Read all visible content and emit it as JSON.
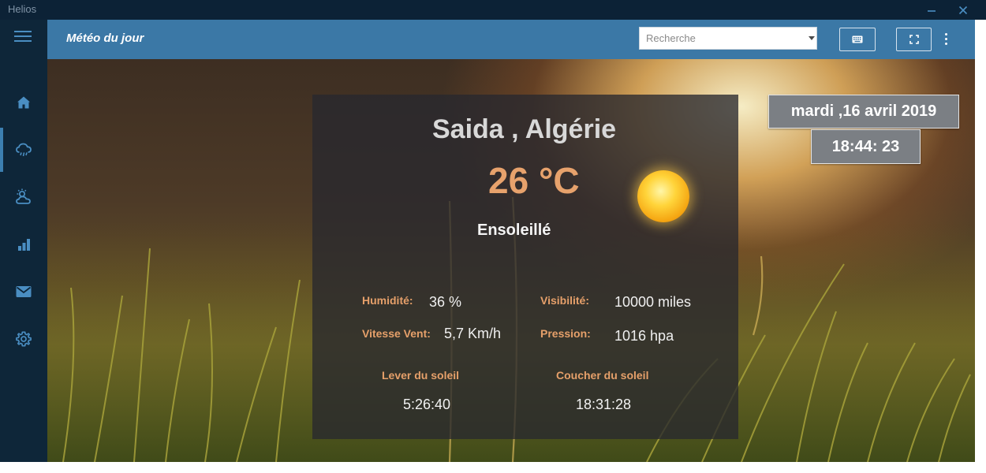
{
  "window": {
    "title": "Helios"
  },
  "header": {
    "title": "Météo du jour",
    "search_placeholder": "Recherche"
  },
  "sidebar": {
    "items": [
      {
        "icon": "home-icon"
      },
      {
        "icon": "cloud-rain-icon",
        "active": true
      },
      {
        "icon": "sun-cloud-icon"
      },
      {
        "icon": "bar-chart-icon"
      },
      {
        "icon": "mail-icon"
      },
      {
        "icon": "gear-icon"
      }
    ]
  },
  "weather": {
    "city": "Saida , Algérie",
    "temperature": "26 °C",
    "condition": "Ensoleillé",
    "humidity_label": "Humidité:",
    "humidity_value": "36 %",
    "visibility_label": "Visibilité:",
    "visibility_value": "10000 miles",
    "wind_label": "Vitesse Vent:",
    "wind_value": "5,7 Km/h",
    "pressure_label": "Pression:",
    "pressure_value": "1016 hpa",
    "sunrise_label": "Lever du soleil",
    "sunrise_value": "5:26:40",
    "sunset_label": "Coucher du soleil",
    "sunset_value": "18:31:28"
  },
  "clock": {
    "date": "mardi ,16 avril 2019",
    "time": "18:44: 23"
  },
  "colors": {
    "titlebar": "#0c2236",
    "sidebar": "#0e2639",
    "header": "#3b78a6",
    "icon_accent": "#4a8ec2",
    "label_accent": "#e6a06a"
  }
}
